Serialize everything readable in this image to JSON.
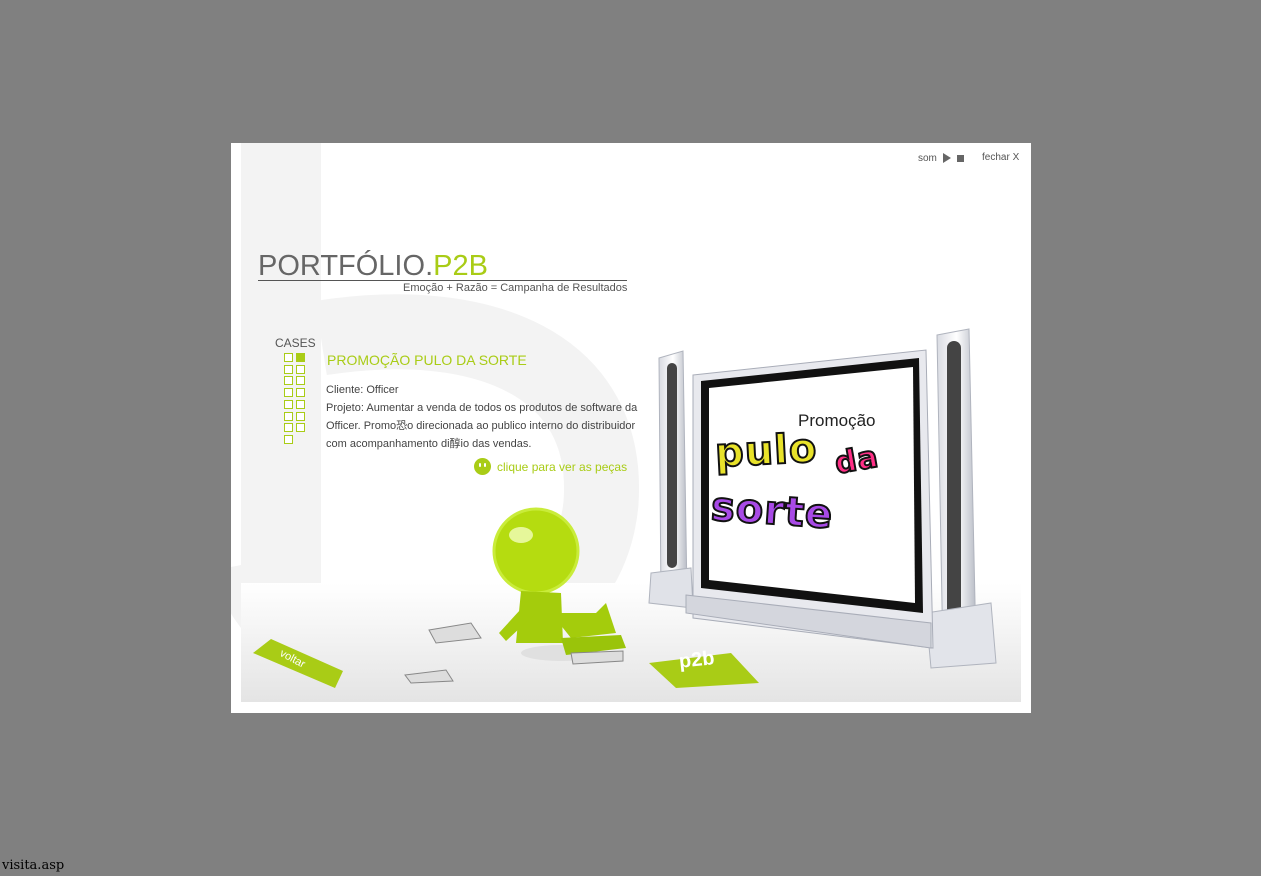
{
  "controls": {
    "sound_label": "som",
    "close_label": "fechar X"
  },
  "header": {
    "title_main": "PORTFÓLIO",
    "title_dot": ".",
    "title_accent": "P2B",
    "tagline": "Emoção + Razão = Campanha de Resultados"
  },
  "cases": {
    "label": "CASES",
    "grid_count": 15,
    "active_index": 1
  },
  "case": {
    "title": "PROMOÇÃO PULO DA SORTE",
    "client": "Cliente: Officer",
    "project_lines": [
      "Projeto: Aumentar a venda de todos os produtos de software da",
      "Officer. Promo恐o direcionada ao publico interno do distribuidor",
      "com acompanhamento di醇io das vendas."
    ],
    "cta": "clique para ver as peças"
  },
  "promo_art": {
    "small": "Promoção",
    "word1": "pulo",
    "word2": "da",
    "word3": "sorte"
  },
  "back_button_label": "voltar",
  "logo_card": "p2b",
  "colors": {
    "accent": "#a9cc16",
    "background": "#808080"
  },
  "status_bar": "visita.asp"
}
